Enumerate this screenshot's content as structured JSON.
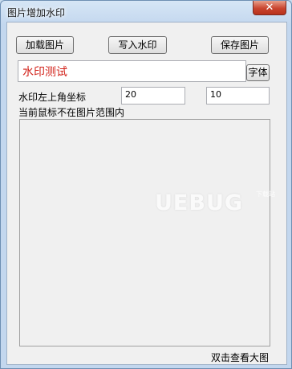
{
  "window": {
    "title": "图片增加水印",
    "close_glyph": "✕"
  },
  "toolbar": {
    "load_label": "加载图片",
    "write_label": "写入水印",
    "save_label": "保存图片"
  },
  "watermark": {
    "text": "水印测试",
    "color": "#d2221a",
    "font_label": "字体"
  },
  "coords": {
    "label": "水印左上角坐标",
    "x": "20",
    "y": "10"
  },
  "status": {
    "mouse_text": "当前鼠标不在图片范围内"
  },
  "hint": {
    "view_large": "双击查看大图"
  },
  "overlay": {
    "logo": "UEBUG",
    "logo_sub": "下载站"
  }
}
